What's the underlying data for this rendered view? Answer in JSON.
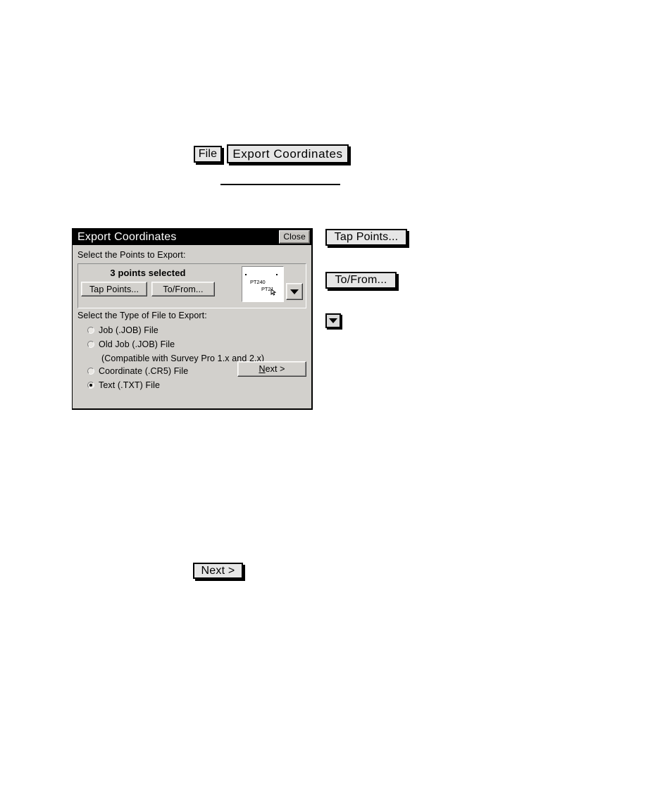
{
  "menu_path": {
    "file_label": "File",
    "command_label": "Export  Coordinates"
  },
  "callouts": {
    "tap_points": "Tap Points...",
    "to_from": "To/From...",
    "dropdown_icon": "caret-down-icon",
    "next": "Next >"
  },
  "dialog": {
    "title": "Export Coordinates",
    "close_label": "Close",
    "points_section": {
      "label": "Select the Points to Export:",
      "selected_text": "3 points selected",
      "tap_points_label": "Tap Points...",
      "to_from_label": "To/From...",
      "dropdown_icon": "caret-down-icon",
      "map_points": [
        {
          "label": "PT240",
          "x": 11,
          "y": 19
        },
        {
          "label": "PT21",
          "x": 27,
          "y": 29
        }
      ],
      "map_dots": [
        {
          "x": 4,
          "y": 10
        },
        {
          "x": 48,
          "y": 10
        }
      ]
    },
    "filetype_section": {
      "label": "Select the Type of File to Export:",
      "options": [
        {
          "label": "Job (.JOB) File",
          "selected": false
        },
        {
          "label": "Old Job (.JOB) File",
          "selected": false,
          "note": "(Compatible with Survey Pro 1.x and 2.x)"
        },
        {
          "label": "Coordinate (.CR5) File",
          "selected": false
        },
        {
          "label": "Text (.TXT) File",
          "selected": true
        }
      ]
    },
    "next_button": {
      "accel": "N",
      "rest": "ext >"
    }
  },
  "colors": {
    "dialog_face": "#d2d0cc",
    "titlebar": "#000000",
    "titlebar_text": "#ffffff",
    "callout_face": "#e6e6e6",
    "page_background": "#ffffff",
    "text": "#000000"
  }
}
